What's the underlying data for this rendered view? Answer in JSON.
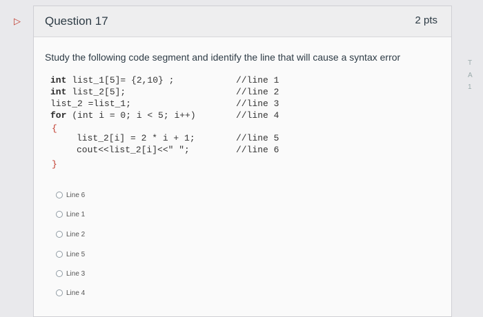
{
  "question": {
    "title": "Question 17",
    "points": "2 pts",
    "prompt": "Study the following code segment and identify the line that will cause a syntax error"
  },
  "code": {
    "line1": "list_1[5]= {2,10} ;",
    "line2": "list_2[5];",
    "line3": "list_2 =list_1;",
    "line4": "(int i = 0; i < 5; i++)",
    "open_brace": "{",
    "line5": "list_2[i] = 2 * i + 1;",
    "line6": "cout<<list_2[i]<<\" \";",
    "close_brace": "}",
    "kw_int": "int",
    "kw_for": "for",
    "comments": [
      "//line 1",
      "//line 2",
      "//line 3",
      "//line 4",
      "//line 5",
      "//line 6"
    ]
  },
  "options": [
    "Line 6",
    "Line 1",
    "Line 2",
    "Line 5",
    "Line 3",
    "Line 4"
  ],
  "side": [
    "T",
    "A",
    "1"
  ]
}
